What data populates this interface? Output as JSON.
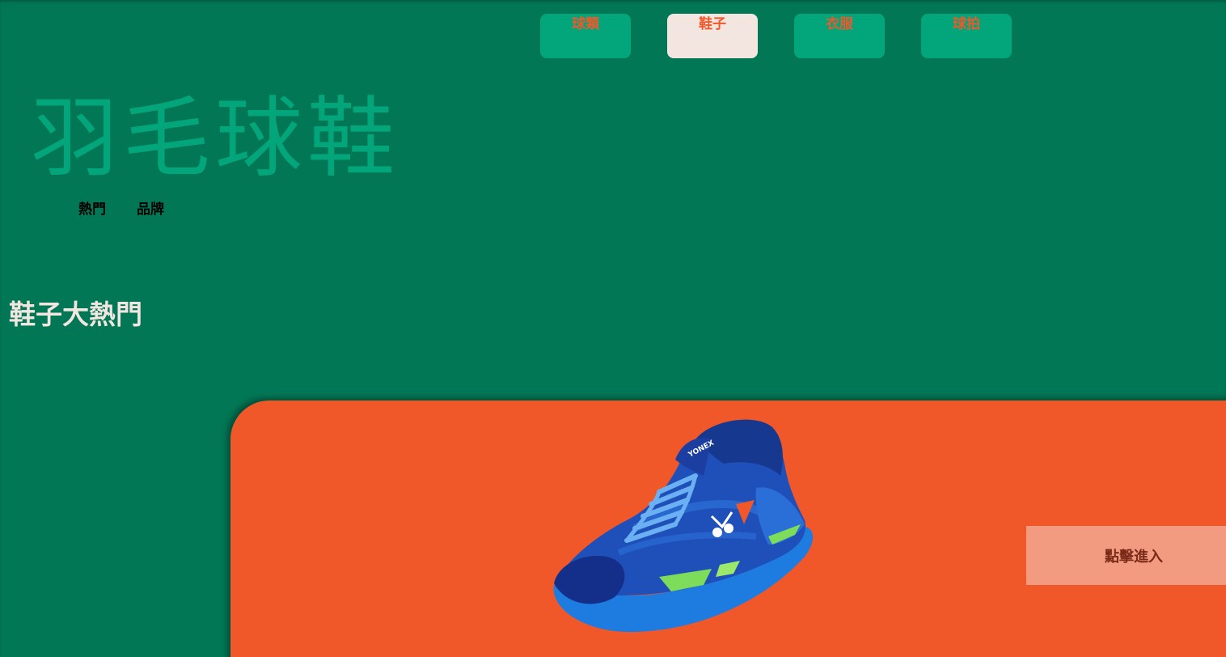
{
  "nav": {
    "items": [
      {
        "label": "球類",
        "active": false
      },
      {
        "label": "鞋子",
        "active": true
      },
      {
        "label": "衣服",
        "active": false
      },
      {
        "label": "球拍",
        "active": false
      }
    ]
  },
  "hero": {
    "title": "羽毛球鞋"
  },
  "subnav": {
    "hot": "熱門",
    "brand": "品牌"
  },
  "section": {
    "title": "鞋子大熱門"
  },
  "card": {
    "shoe_brand": "YONEX",
    "button_label": "點擊進入"
  },
  "colors": {
    "background": "#027755",
    "accent_green": "#03a57a",
    "accent_orange": "#f0582a",
    "cream": "#f3e6e1",
    "button_salmon": "#f39b80",
    "shoe_blue": "#1a4fb3"
  }
}
